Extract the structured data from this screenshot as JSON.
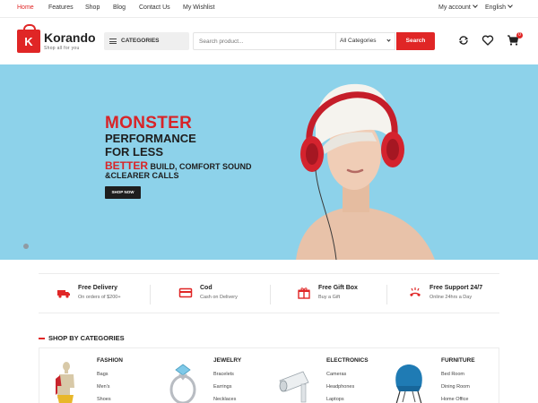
{
  "topbar": {
    "nav": [
      {
        "label": "Home",
        "active": true
      },
      {
        "label": "Features",
        "active": false
      },
      {
        "label": "Shop",
        "active": false
      },
      {
        "label": "Blog",
        "active": false
      },
      {
        "label": "Contact Us",
        "active": false
      },
      {
        "label": "My Wishlist",
        "active": false
      }
    ],
    "account_label": "My account",
    "language_label": "English"
  },
  "header": {
    "logo_letter": "K",
    "logo_name": "Korando",
    "logo_tagline": "Shop all for you",
    "categories_label": "CATEGORIES",
    "search_placeholder": "Search product...",
    "search_category": "All Categories",
    "search_button": "Search",
    "cart_count": "0",
    "icons": [
      "compare-icon",
      "heart-icon",
      "cart-icon"
    ]
  },
  "hero": {
    "line1": "MONSTER",
    "line2": "PERFORMANCE",
    "line3": "FOR LESS",
    "line4_accent": "BETTER",
    "line4_rest": " BUILD, COMFORT SOUND",
    "line5": "&CLEARER CALLS",
    "button": "SHOP NOW"
  },
  "features": [
    {
      "title": "Free Delivery",
      "sub": "On orders of $200+",
      "icon": "truck-icon"
    },
    {
      "title": "Cod",
      "sub": "Cash on Delivery",
      "icon": "card-icon"
    },
    {
      "title": "Free Gift Box",
      "sub": "Buy a Gift",
      "icon": "gift-icon"
    },
    {
      "title": "Free Support 24/7",
      "sub": "Online 24hrs a Day",
      "icon": "phone-icon"
    }
  ],
  "categories_section": {
    "title": "SHOP BY CATEGORIES",
    "columns": [
      {
        "title": "FASHION",
        "items": [
          "Bags",
          "Men's",
          "Shoes"
        ]
      },
      {
        "title": "JEWELRY",
        "items": [
          "Bracelets",
          "Earrings",
          "Necklaces"
        ]
      },
      {
        "title": "ELECTRONICS",
        "items": [
          "Cameras",
          "Headphones",
          "Laptops"
        ]
      },
      {
        "title": "FURNITURE",
        "items": [
          "Bed Room",
          "Dining Room",
          "Home Office"
        ]
      }
    ]
  },
  "colors": {
    "accent": "#e02626",
    "hero_bg": "#8dd2ea",
    "dark": "#1e1e1e"
  }
}
